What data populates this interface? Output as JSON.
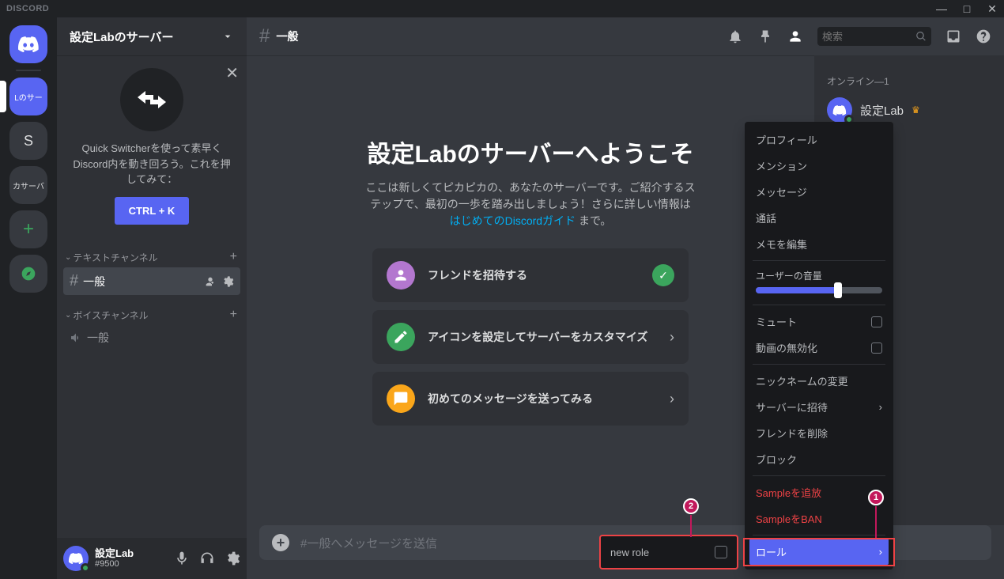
{
  "titlebar": {
    "logo": "DISCORD"
  },
  "server": {
    "name": "設定Labのサーバー",
    "quickSwitcher": {
      "text": "Quick Switcherを使って素早くDiscord内を動き回ろう。これを押してみて：",
      "key": "CTRL + K"
    }
  },
  "channels": {
    "textCategory": "テキストチャンネル",
    "voiceCategory": "ボイスチャンネル",
    "general": "一般",
    "voiceGeneral": "一般"
  },
  "user": {
    "name": "設定Lab",
    "tag": "#9500"
  },
  "header": {
    "channel": "一般",
    "searchPlaceholder": "検索"
  },
  "welcome": {
    "title": "設定Labのサーバーへようこそ",
    "desc_pre": "ここは新しくてピカピカの、あなたのサーバーです。ご紹介するステップで、最初の一歩を踏み出しましょう！さらに詳しい情報は ",
    "desc_link": "はじめてのDiscordガイド",
    "desc_post": " まで。",
    "actions": {
      "invite": "フレンドを招待する",
      "customize": "アイコンを設定してサーバーをカスタマイズ",
      "firstMessage": "初めてのメッセージを送ってみる"
    }
  },
  "input": {
    "placeholder": "#一般へメッセージを送信"
  },
  "members": {
    "onlineHeader": "オンライン—1",
    "user": "設定Lab"
  },
  "contextMenu": {
    "profile": "プロフィール",
    "mention": "メンション",
    "message": "メッセージ",
    "call": "通話",
    "editNote": "メモを編集",
    "volume": "ユーザーの音量",
    "mute": "ミュート",
    "disableVideo": "動画の無効化",
    "changeNick": "ニックネームの変更",
    "inviteServer": "サーバーに招待",
    "removeFriend": "フレンドを削除",
    "block": "ブロック",
    "kick": "Sampleを追放",
    "ban": "SampleをBAN",
    "roles": "ロール"
  },
  "roleSubmenu": {
    "newRole": "new role"
  },
  "annotations": {
    "one": "1",
    "two": "2"
  }
}
